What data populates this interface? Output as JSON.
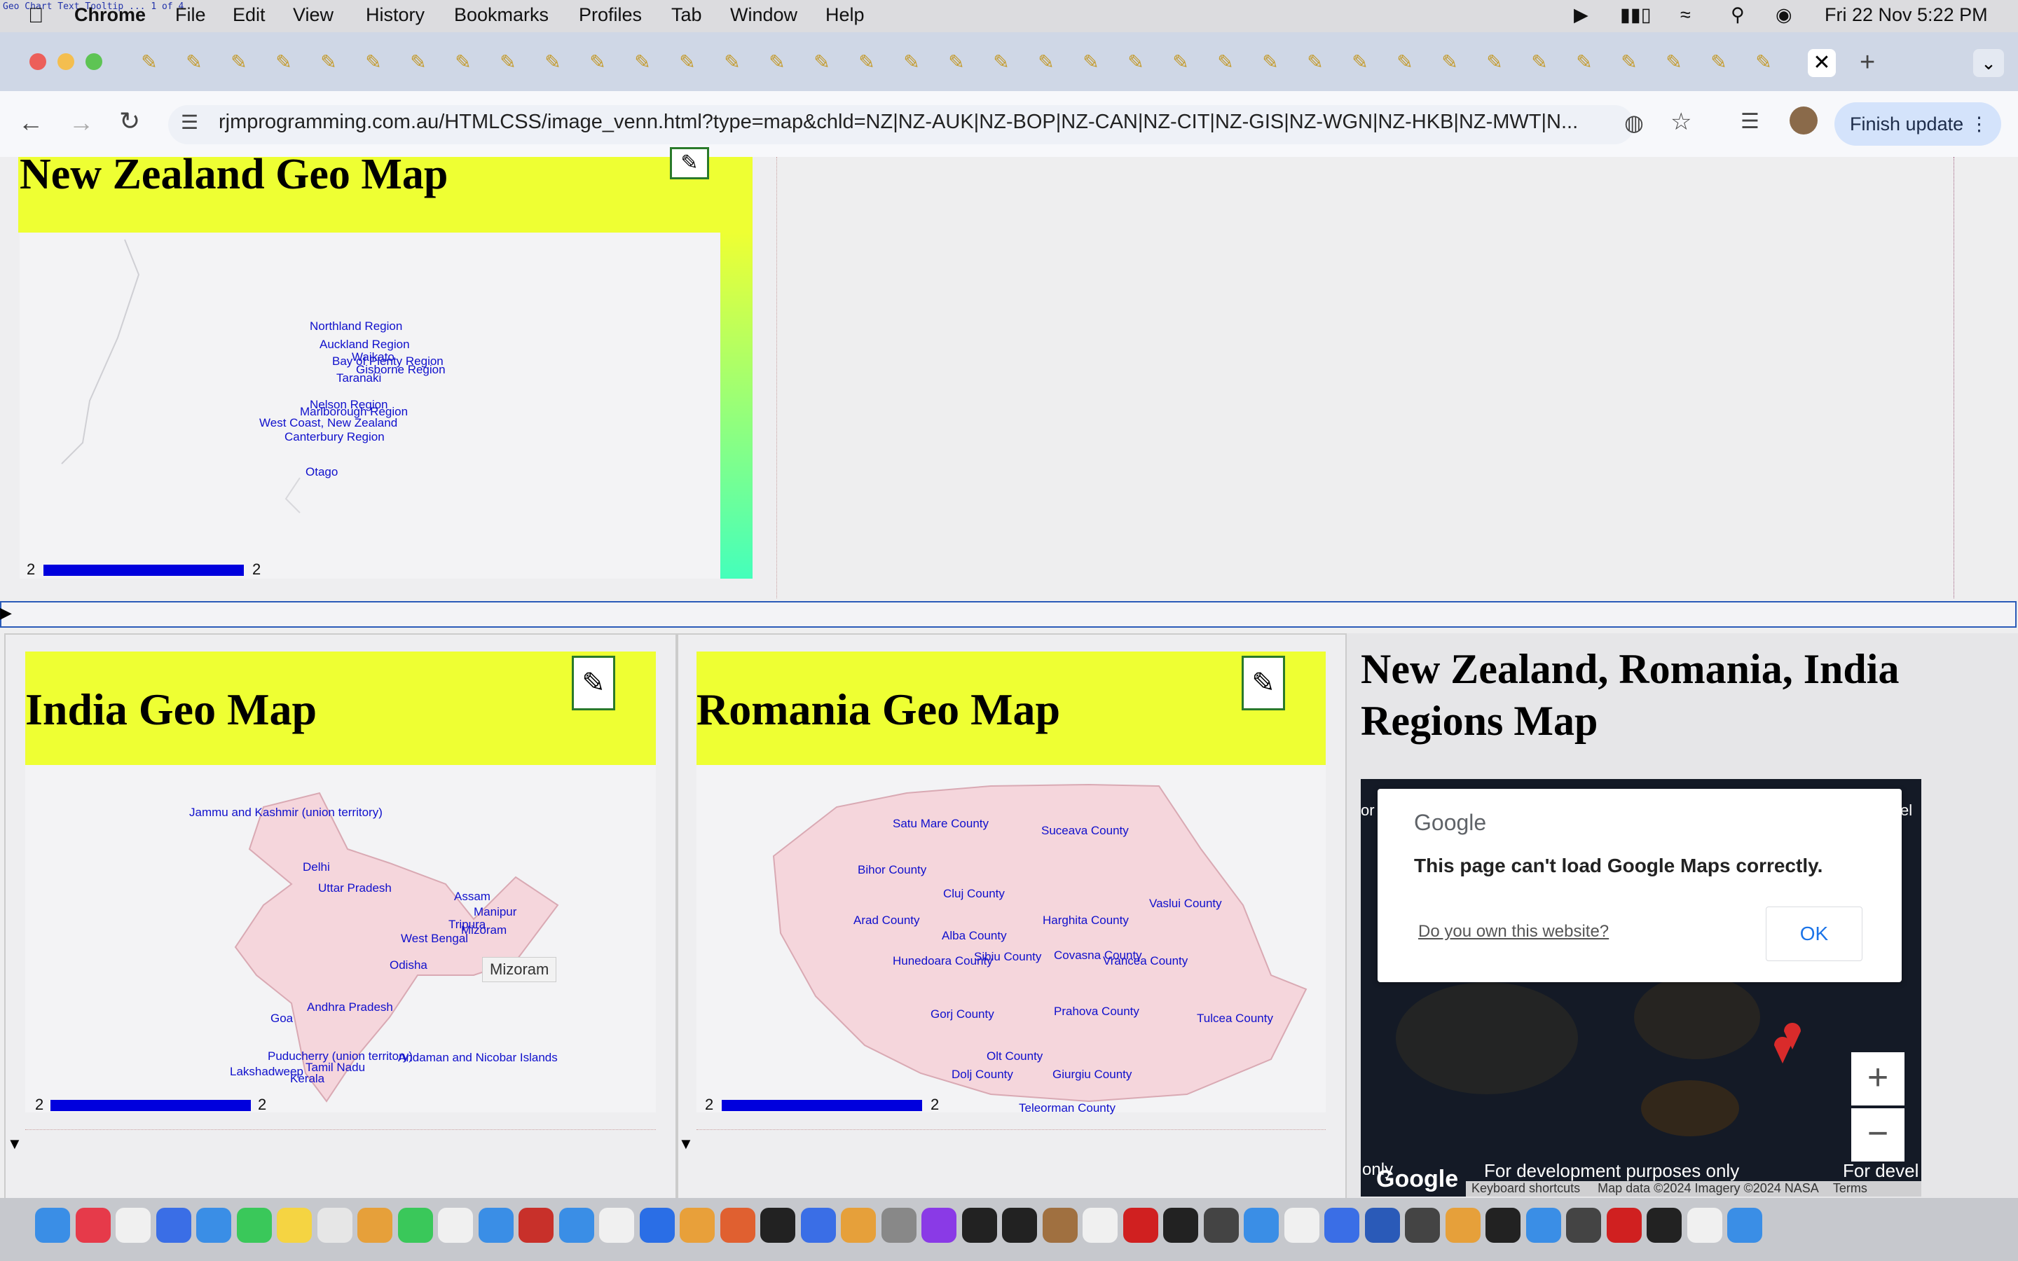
{
  "menubar": {
    "app_name": "Chrome",
    "items": [
      "File",
      "Edit",
      "View",
      "History",
      "Bookmarks",
      "Profiles",
      "Tab",
      "Window",
      "Help"
    ],
    "clock": "Fri 22 Nov  5:22 PM",
    "corner_text": "Geo Chart Text Tooltip ... 1 of 4"
  },
  "toolbar": {
    "url": "rjmprogramming.com.au/HTMLCSS/image_venn.html?type=map&chld=NZ|NZ-AUK|NZ-BOP|NZ-CAN|NZ-CIT|NZ-GIS|NZ-WGN|NZ-HKB|NZ-MWT|N...",
    "finish_update": "Finish update"
  },
  "nz_map": {
    "title": "New Zealand Geo Map",
    "labels": [
      "Northland Region",
      "Auckland Region",
      "Waikato",
      "Bay of Plenty Region",
      "Gisborne Region",
      "Taranaki",
      "Nelson Region",
      "Marlborough Region",
      "West Coast, New Zealand",
      "Canterbury Region",
      "Otago"
    ],
    "legend_min": "2",
    "legend_max": "2"
  },
  "india_map": {
    "title": "India Geo Map",
    "labels": [
      "Jammu and Kashmir (union territory)",
      "Delhi",
      "Uttar Pradesh",
      "Assam",
      "Manipur",
      "Tripura",
      "Mizoram",
      "West Bengal",
      "Odisha",
      "Andhra Pradesh",
      "Goa",
      "Puducherry (union territory)",
      "Andaman and Nicobar Islands",
      "Lakshadweep",
      "Tamil Nadu",
      "Kerala"
    ],
    "tooltip": "Mizoram",
    "legend_min": "2",
    "legend_max": "2"
  },
  "romania_map": {
    "title": "Romania Geo Map",
    "labels": [
      "Satu Mare County",
      "Suceava County",
      "Bihor County",
      "Cluj County",
      "Vaslui County",
      "Arad County",
      "Harghita County",
      "Alba County",
      "Hunedoara County",
      "Sibiu County",
      "Covasna County",
      "Vrancea County",
      "Gorj County",
      "Prahova County",
      "Tulcea County",
      "Olt County",
      "Dolj County",
      "Giurgiu County",
      "Teleorman County"
    ],
    "legend_min": "2",
    "legend_max": "2"
  },
  "regions_panel": {
    "title": "New Zealand, Romania, India Regions Map",
    "dialog_brand": "Google",
    "dialog_message": "This page can't load Google Maps correctly.",
    "dialog_link": "Do you own this website?",
    "dialog_ok": "OK",
    "watermark_left": "For development purposes only",
    "watermark_right": "For devel",
    "footer_brand": "Google",
    "footer_shortcuts": "Keyboard shortcuts",
    "footer_mapdata": "Map data ©2024 Imagery ©2024 NASA",
    "footer_terms": "Terms",
    "zoom_in": "+",
    "zoom_out": "−",
    "edge_left": "or",
    "edge_right": "el",
    "only": "only"
  },
  "colors": {
    "accent_yellow": "#eeff33",
    "legend_blue": "#0000dd",
    "label_blue": "#1010cc",
    "dialog_blue": "#1a73e8"
  }
}
